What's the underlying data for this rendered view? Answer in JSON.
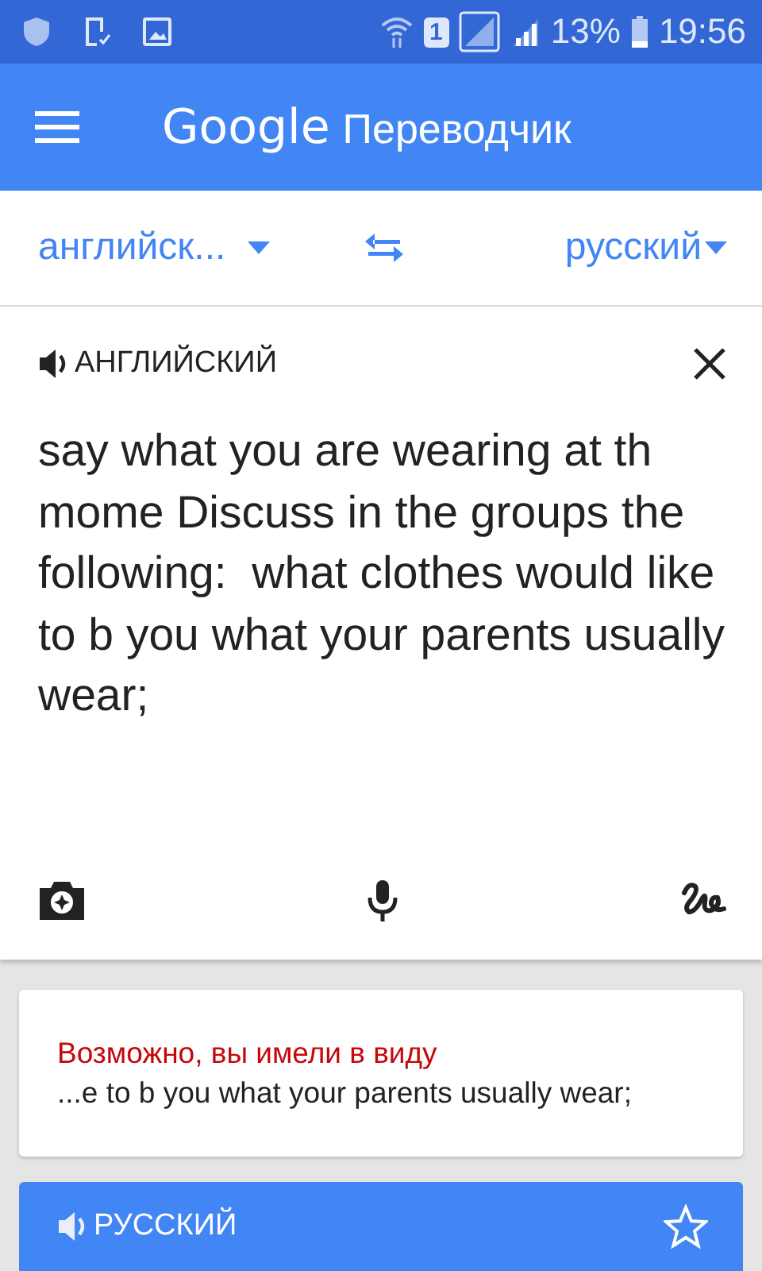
{
  "status_bar": {
    "sim": "1",
    "battery": "13%",
    "time": "19:56"
  },
  "app_bar": {
    "logo": "Google",
    "title": "Переводчик"
  },
  "languages": {
    "source": "английск...",
    "target": "русский"
  },
  "input": {
    "language": "АНГЛИЙСКИЙ",
    "value": "say what you are wearing at th mome Discuss in the groups the following:  what clothes would like to b you what your parents usually wear;"
  },
  "suggestion": {
    "heading": "Возможно, вы имели в виду",
    "text": "...e to b you what your parents usually wear;"
  },
  "result": {
    "language": "РУССКИЙ",
    "starred": false
  }
}
